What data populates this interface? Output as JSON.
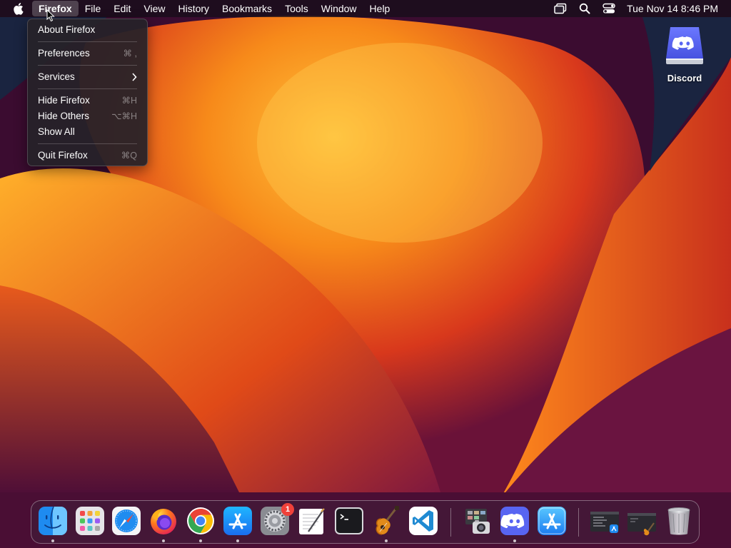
{
  "menubar": {
    "apple": "apple-icon",
    "items": [
      {
        "label": "Firefox",
        "active": true
      },
      {
        "label": "File"
      },
      {
        "label": "Edit"
      },
      {
        "label": "View"
      },
      {
        "label": "History"
      },
      {
        "label": "Bookmarks"
      },
      {
        "label": "Tools"
      },
      {
        "label": "Window"
      },
      {
        "label": "Help"
      }
    ],
    "status_icons": [
      "screen-mirroring-icon",
      "spotlight-search-icon",
      "control-center-icon"
    ],
    "clock": "Tue Nov 14  8:46 PM"
  },
  "app_menu": {
    "items": [
      {
        "label": "About Firefox",
        "shortcut": ""
      },
      {
        "label": "Preferences",
        "shortcut": "⌘ ,"
      },
      {
        "label": "Services",
        "shortcut": ""
      },
      {
        "label": "Hide Firefox",
        "shortcut": "⌘H"
      },
      {
        "label": "Hide Others",
        "shortcut": "⌥⌘H"
      },
      {
        "label": "Show All",
        "shortcut": ""
      },
      {
        "label": "Quit Firefox",
        "shortcut": "⌘Q"
      }
    ]
  },
  "desktop": {
    "icons": [
      {
        "label": "Discord",
        "icon": "discord-drive-icon"
      }
    ]
  },
  "dock": {
    "apps": [
      {
        "icon": "finder-icon",
        "running": true
      },
      {
        "icon": "launchpad-icon",
        "running": false
      },
      {
        "icon": "safari-icon",
        "running": false
      },
      {
        "icon": "firefox-icon",
        "running": true
      },
      {
        "icon": "chrome-icon",
        "running": true
      },
      {
        "icon": "app-store-icon",
        "running": true
      },
      {
        "icon": "system-settings-icon",
        "running": false,
        "badge": "1"
      },
      {
        "icon": "textedit-icon",
        "running": false
      },
      {
        "icon": "terminal-icon",
        "running": false
      },
      {
        "icon": "garageband-icon",
        "running": true
      },
      {
        "icon": "vscode-icon",
        "running": false
      },
      {
        "icon": "image-capture-icon",
        "running": false
      },
      {
        "icon": "discord-icon",
        "running": true
      },
      {
        "icon": "app-store-installer-icon",
        "running": false
      },
      {
        "icon": "minimized-window-icon",
        "running": false
      },
      {
        "icon": "minimized-window-icon",
        "running": false
      },
      {
        "icon": "trash-icon",
        "running": false
      }
    ]
  },
  "colors": {
    "menubar_bg": "#140e18",
    "badge": "#f0413a",
    "discord": "#5865f2",
    "wallpaper_orange": "#f7a21b",
    "wallpaper_red": "#e0421a",
    "wallpaper_purple": "#5a1040"
  }
}
